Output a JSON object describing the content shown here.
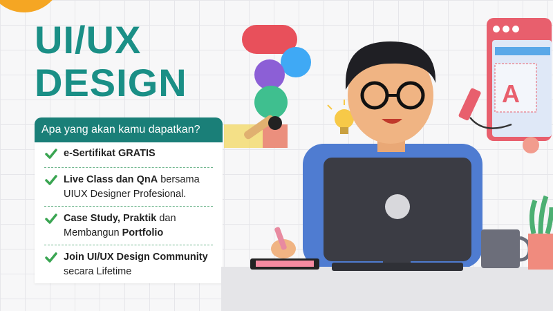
{
  "title": {
    "line1": "UI/UX",
    "line2": "DESIGN"
  },
  "benefits": {
    "header": "Apa yang akan kamu dapatkan?",
    "items": [
      {
        "bold1": "e-Sertifikat GRATIS",
        "text1": "",
        "bold2": "",
        "text2": ""
      },
      {
        "bold1": "Live Class dan QnA",
        "text1": " bersama UIUX Designer Profesional.",
        "bold2": "",
        "text2": ""
      },
      {
        "bold1": "Case Study, Praktik",
        "text1": " dan Membangun ",
        "bold2": "Portfolio",
        "text2": ""
      },
      {
        "bold1": "Join UI/UX Design Community",
        "text1": " secara Lifetime",
        "bold2": "",
        "text2": ""
      }
    ]
  },
  "colors": {
    "teal": "#1a8f86",
    "header_bg": "#1a7f78",
    "check": "#3aa552",
    "accent": "#f5a623"
  },
  "illustration": {
    "icons": [
      "figma-logo-icon",
      "lightbulb-icon",
      "design-window-icon",
      "pen-icon",
      "laptop-icon",
      "mug-icon",
      "plant-icon",
      "tablet-icon"
    ]
  }
}
